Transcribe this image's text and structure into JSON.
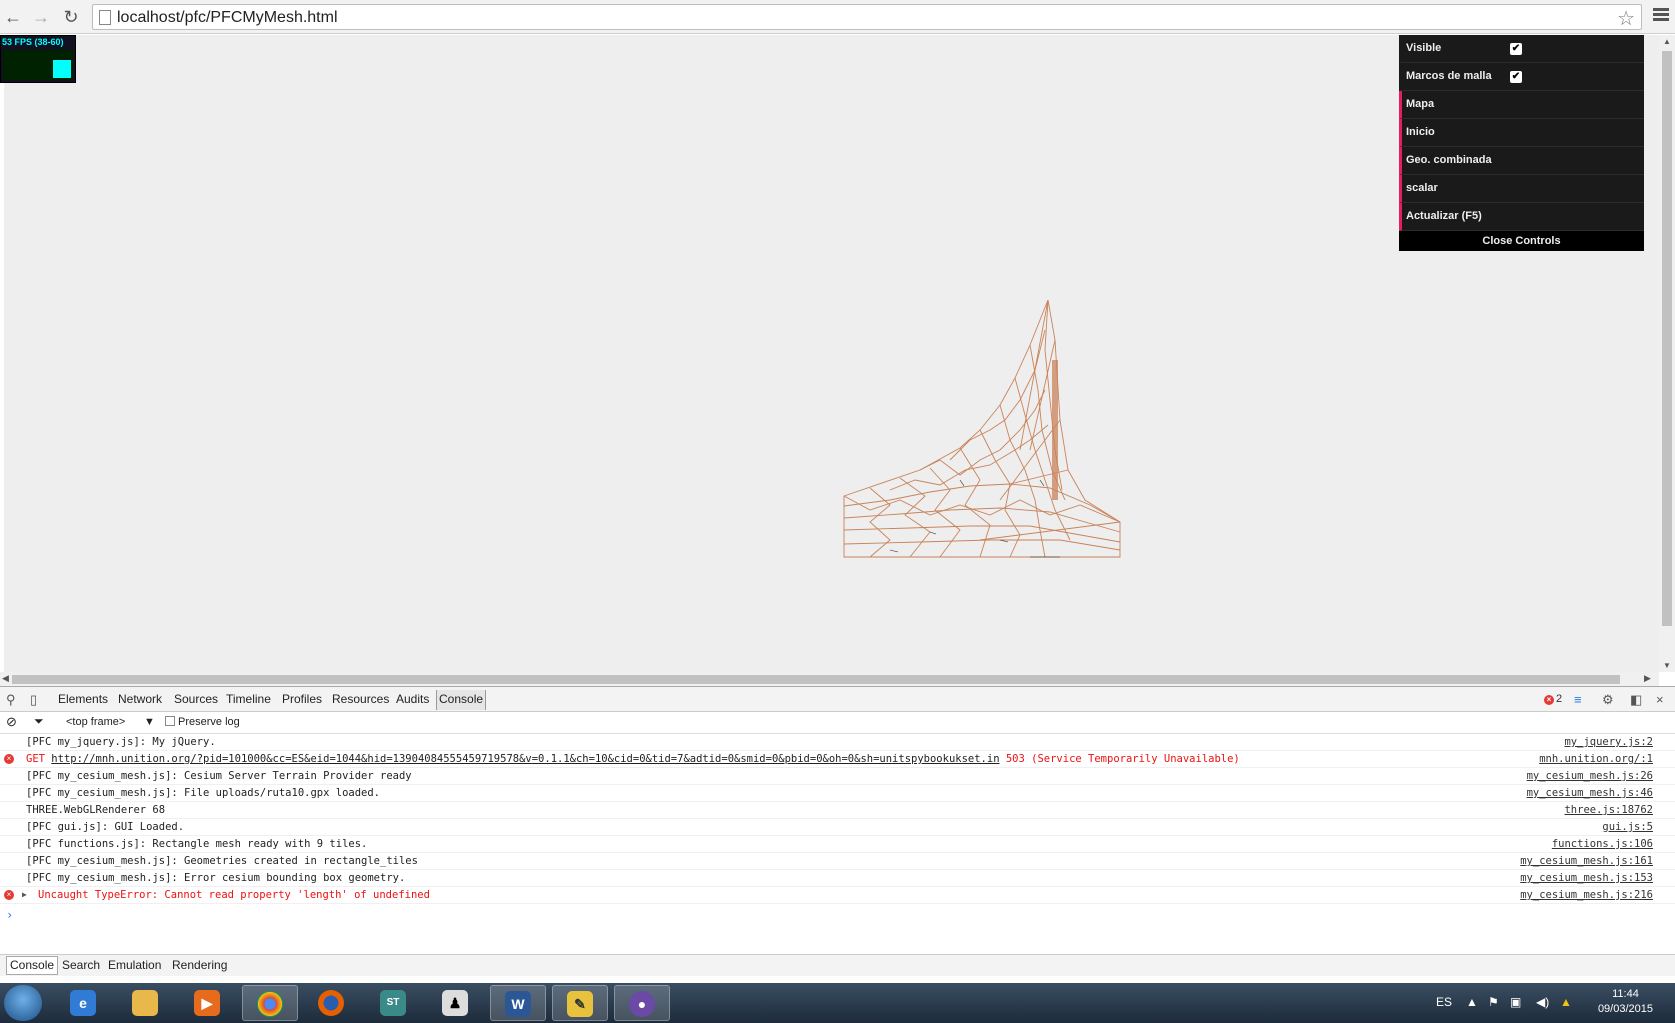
{
  "browser": {
    "url": "localhost/pfc/PFCMyMesh.html"
  },
  "stats": {
    "fps_text": "53 FPS (38-60)"
  },
  "gui": {
    "rows": [
      {
        "label": "Visible",
        "checked": true
      },
      {
        "label": "Marcos de malla",
        "checked": true
      },
      {
        "label": "Mapa"
      },
      {
        "label": "Inicio"
      },
      {
        "label": "Geo. combinada"
      },
      {
        "label": "scalar"
      },
      {
        "label": "Actualizar (F5)"
      }
    ],
    "close_label": "Close Controls",
    "checkmark": "✔"
  },
  "devtools": {
    "tabs": [
      "Elements",
      "Network",
      "Sources",
      "Timeline",
      "Profiles",
      "Resources",
      "Audits",
      "Console"
    ],
    "error_count": "2",
    "frame_selector": "<top frame>",
    "preserve_log": "Preserve log",
    "drawer_tabs": [
      "Console",
      "Search",
      "Emulation",
      "Rendering"
    ]
  },
  "console": {
    "lines": [
      {
        "msg": "[PFC my_jquery.js]: My jQuery.",
        "src": "my_jquery.js:2"
      },
      {
        "pre": "GET ",
        "link": "http://mnh.unition.org/?pid=101000&cc=ES&eid=1044&hid=13904084555459719578&v=0.1.1&ch=10&cid=0&tid=7&adtid=0&smid=0&pbid=0&oh=0&sh=unitspybookukset.in",
        "post": " 503 (Service Temporarily Unavailable)",
        "src": "mnh.unition.org/:1"
      },
      {
        "msg": "[PFC my_cesium_mesh.js]: Cesium Server Terrain Provider ready",
        "src": "my_cesium_mesh.js:26"
      },
      {
        "msg": "[PFC my_cesium_mesh.js]: File uploads/ruta10.gpx loaded.",
        "src": "my_cesium_mesh.js:46"
      },
      {
        "msg": "THREE.WebGLRenderer 68",
        "src": "three.js:18762"
      },
      {
        "msg": "[PFC gui.js]: GUI Loaded.",
        "src": "gui.js:5"
      },
      {
        "msg": "[PFC functions.js]: Rectangle mesh ready with 9 tiles.",
        "src": "functions.js:106"
      },
      {
        "msg": "[PFC my_cesium_mesh.js]: Geometries created in rectangle_tiles",
        "src": "my_cesium_mesh.js:161"
      },
      {
        "msg": "[PFC my_cesium_mesh.js]: Error cesium bounding box geometry.",
        "src": "my_cesium_mesh.js:153"
      },
      {
        "msg": "Uncaught TypeError: Cannot read property 'length' of undefined",
        "src": "my_cesium_mesh.js:216"
      }
    ],
    "prompt": "›",
    "error_icon": "×"
  },
  "taskbar": {
    "lang": "ES",
    "time": "11:44",
    "date": "09/03/2015",
    "apps": [
      "ie-icon",
      "explorer-icon",
      "media-player-icon",
      "chrome-icon",
      "firefox-icon",
      "sourcetree-icon",
      "inkscape-icon",
      "word-icon",
      "sublime-icon",
      "github-icon"
    ],
    "colors": {
      "mesh": "#c8835a",
      "gui_accent": "#e61d5f",
      "error": "#e11111"
    }
  }
}
